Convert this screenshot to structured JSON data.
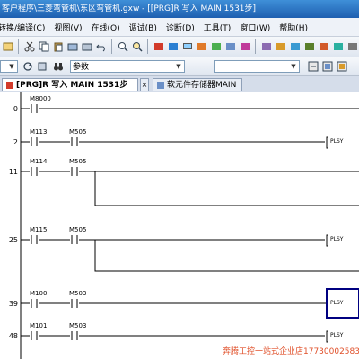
{
  "window": {
    "title": "客户程序\\三菱弯管机\\东区弯管机.gxw - [[PRG]R 写入 MAIN 1531步]"
  },
  "menu": {
    "items": [
      "转换/编译(C)",
      "视图(V)",
      "在线(O)",
      "调试(B)",
      "诊断(D)",
      "工具(T)",
      "窗口(W)",
      "帮助(H)"
    ]
  },
  "toolbar2": {
    "search_value": "参数"
  },
  "tabs": [
    {
      "label": "[PRG]R 写入 MAIN 1531步",
      "active": true
    },
    {
      "label": "软元件存储器MAIN",
      "active": false
    }
  ],
  "ladder": {
    "rungs": [
      {
        "step": "0",
        "contacts": [
          "M8000"
        ]
      },
      {
        "step": "2",
        "contacts": [
          "M113",
          "M505"
        ],
        "instruction": "PLSY"
      },
      {
        "step": "11",
        "contacts": [
          "M114",
          "M505"
        ]
      },
      {
        "step": "25",
        "contacts": [
          "M115",
          "M505"
        ],
        "instruction": "PLSY"
      },
      {
        "step": "39",
        "contacts": [
          "M100",
          "M503"
        ],
        "instruction": "PLSY"
      },
      {
        "step": "48",
        "contacts": [
          "M101",
          "M503"
        ],
        "instruction": "PLSY"
      }
    ]
  },
  "watermark": {
    "text": "奔腾工控一站式企业店17730002583"
  },
  "colors": {
    "title_bg": "#1e5fb0",
    "watermark": "#e0502a",
    "selection_box": "#000080"
  }
}
